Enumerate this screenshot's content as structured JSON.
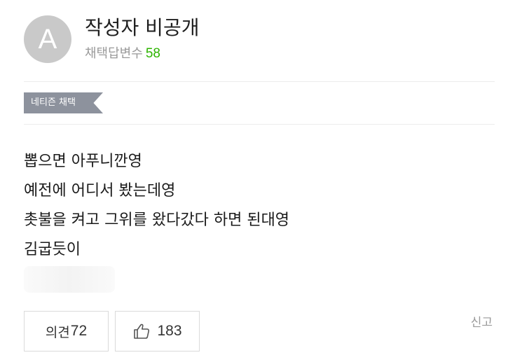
{
  "author": {
    "avatar_letter": "A",
    "name": "작성자 비공개",
    "adopt_label": "채택답변수",
    "adopt_count": "58"
  },
  "badge": {
    "label": "네티즌 채택"
  },
  "answer": {
    "lines": [
      "뽑으면 아푸니깐영",
      "예전에 어디서 봤는데영",
      "촛불을 켜고 그위를 왔다갔다 하면 된대영",
      "김굽듯이"
    ]
  },
  "actions": {
    "opinion_label": "의견",
    "opinion_count": "72",
    "like_icon": "thumbs-up-icon",
    "like_count": "183",
    "report_label": "신고"
  },
  "colors": {
    "badge_bg": "#8d929d",
    "count_green": "#2db400",
    "avatar_bg": "#c9c9c9"
  }
}
